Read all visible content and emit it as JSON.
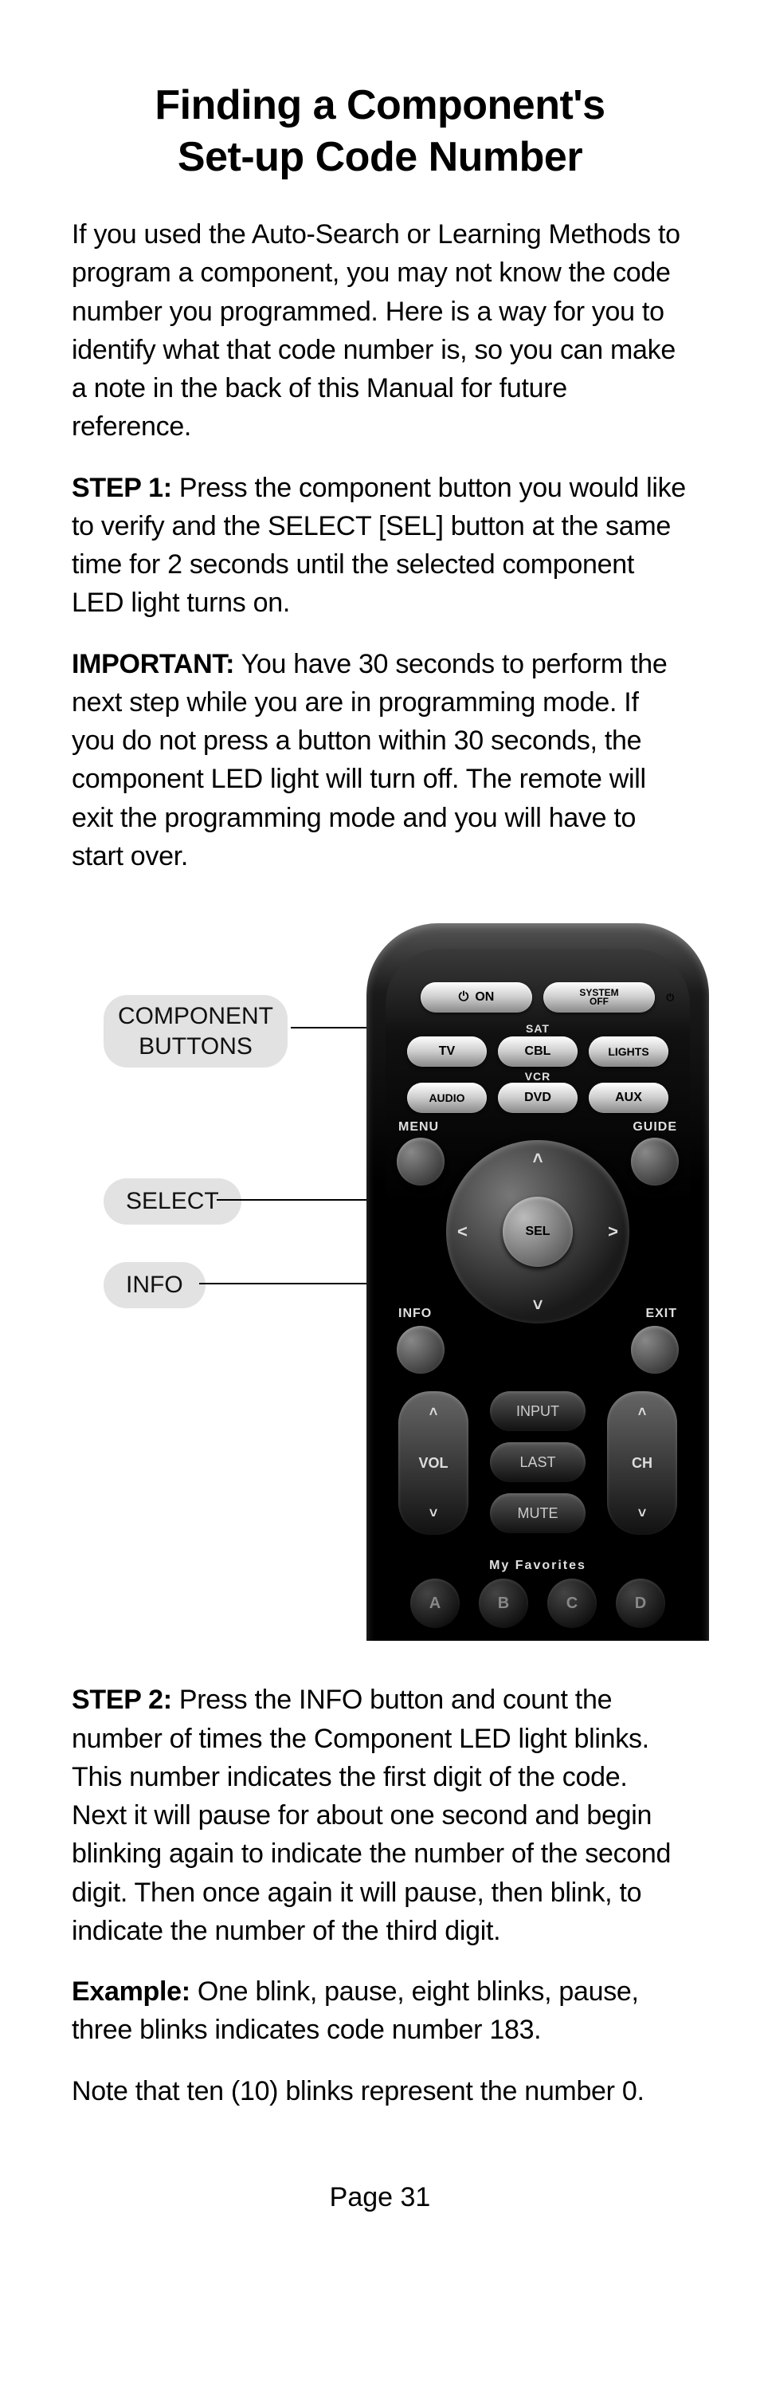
{
  "title_line1": "Finding a Component's",
  "title_line2": "Set-up Code Number",
  "intro": "If you used the Auto-Search or Learning Methods to program a component, you may not know the code number you programmed. Here is a way for you to identify what that code number is, so you can make a note in the back of this Manual for future reference.",
  "step1_lead": "STEP 1:",
  "step1_body": " Press the component button you would like to verify and the SELECT [SEL] button at the same time for 2 seconds until the selected component LED light turns on.",
  "important_lead": "IMPORTANT:",
  "important_body": " You have 30 seconds to perform the next step while you are in programming mode. If you do not press a button within 30 seconds, the component LED light will turn off. The remote will exit the programming mode and you will have to start over.",
  "callouts": {
    "component_line1": "COMPONENT",
    "component_line2": "BUTTONS",
    "select": "SELECT",
    "info": "INFO"
  },
  "remote": {
    "on": "ON",
    "system_off_1": "SYSTEM",
    "system_off_2": "OFF",
    "sat": "SAT",
    "tv": "TV",
    "cbl": "CBL",
    "lights": "LIGHTS",
    "vcr": "VCR",
    "audio": "AUDIO",
    "dvd": "DVD",
    "aux": "AUX",
    "menu": "MENU",
    "guide": "GUIDE",
    "sel": "SEL",
    "info": "INFO",
    "exit": "EXIT",
    "input": "INPUT",
    "vol": "VOL",
    "last": "LAST",
    "ch": "CH",
    "mute": "MUTE",
    "favorites": "My Favorites",
    "a": "A",
    "b": "B",
    "c": "C",
    "d": "D"
  },
  "step2_lead": "STEP 2:",
  "step2_body": " Press the INFO button and count the number of times the Component LED light blinks. This number indicates the first digit of the code. Next it will pause for about one second and begin blinking again to indicate the number of the second digit. Then once again it will pause, then blink, to indicate the number of the third digit.",
  "example_lead": "Example:",
  "example_body": " One blink, pause, eight blinks, pause, three blinks indicates code number 183.",
  "note": "Note that ten (10) blinks represent the number 0.",
  "page_number": "Page 31"
}
